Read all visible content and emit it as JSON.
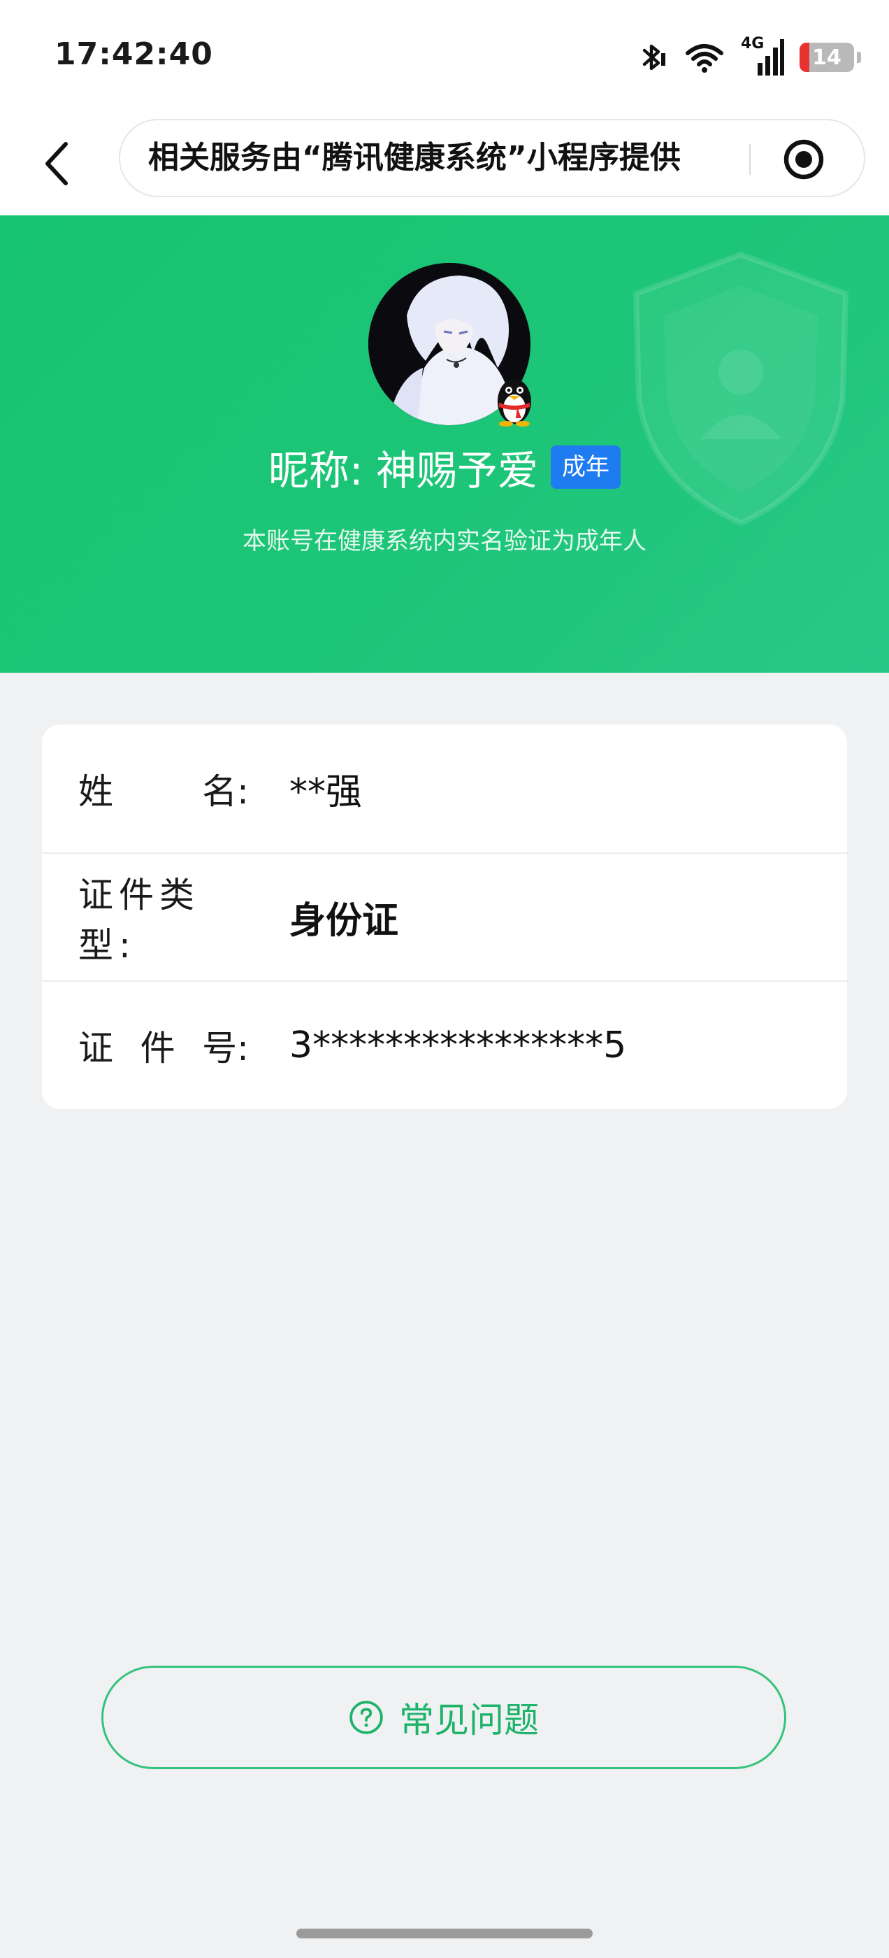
{
  "status_bar": {
    "time": "17:42:40",
    "network": "4G",
    "battery_level": "14",
    "icons": [
      "bluetooth-icon",
      "wifi-icon",
      "cellular-signal-icon",
      "battery-icon"
    ]
  },
  "nav": {
    "title": "相关服务由“腾讯健康系统”小程序提供",
    "back_icon": "chevron-left-icon",
    "menu_icon": "target-icon"
  },
  "profile": {
    "nickname": "昵称: 神赐予爱",
    "badge": "成年",
    "verify_text": "本账号在健康系统内实名验证为成年人"
  },
  "info": {
    "name_label_chars": [
      "姓",
      "名:"
    ],
    "name_value": "**强",
    "id_type_label": "证件类型:",
    "id_type_value": "身份证",
    "id_number_label_chars": [
      "证",
      "件",
      "号:"
    ],
    "id_number_value": "3****************5"
  },
  "faq": {
    "label": "常见问题",
    "icon": "question-circle-icon"
  },
  "colors": {
    "brand_green": "#1dc578",
    "badge_blue": "#1f7cf0",
    "faq_green": "#1db46a",
    "background": "#f0f1f3"
  }
}
